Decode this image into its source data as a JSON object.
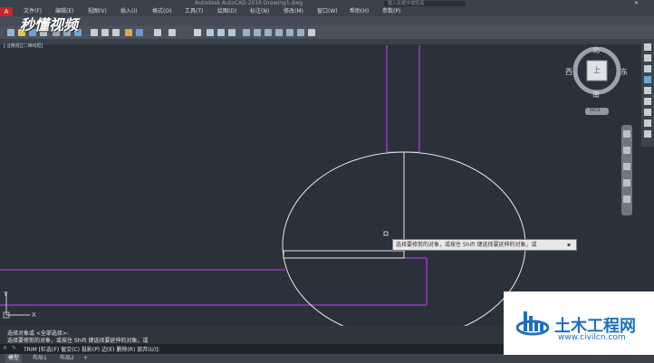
{
  "app": {
    "title": "Autodesk AutoCAD 2016    Drawing1.dwg",
    "search_placeholder": "键入关键字或短语"
  },
  "menu": [
    "文件(F)",
    "编辑(E)",
    "视图(V)",
    "插入(I)",
    "格式(O)",
    "工具(T)",
    "绘图(D)",
    "标注(N)",
    "修改(M)",
    "窗口(W)",
    "帮助(H)",
    "参数(P)"
  ],
  "viewport_label": "[-][俯视][二维线框]",
  "viewcube": {
    "north": "北",
    "south": "南",
    "west": "西",
    "east": "东",
    "face": "上",
    "wcs": "WCS"
  },
  "tooltip": "选择要修剪的对象，或按住 Shift 键选择要延伸的对象，或",
  "command": {
    "history1": "选择对象或 <全部选择>:",
    "history2": "选择要修剪的对象，或按住 Shift 键选择要延伸的对象，或",
    "prompt": "TRIM [栏选(F) 窗交(C) 投影(P) 边(E) 删除(R) 放弃(U)]:"
  },
  "status_tabs": [
    "模型",
    "布局1",
    "布局2",
    "+"
  ],
  "watermark": {
    "left": "秒懂视频",
    "right_title": "土木工程网",
    "right_url": "www.civilcn.com"
  },
  "colors": {
    "canvas": "#2b313b",
    "purple": "#a93ad8",
    "white_line": "#e6e6e6",
    "wm_blue": "#1e6fc0"
  }
}
